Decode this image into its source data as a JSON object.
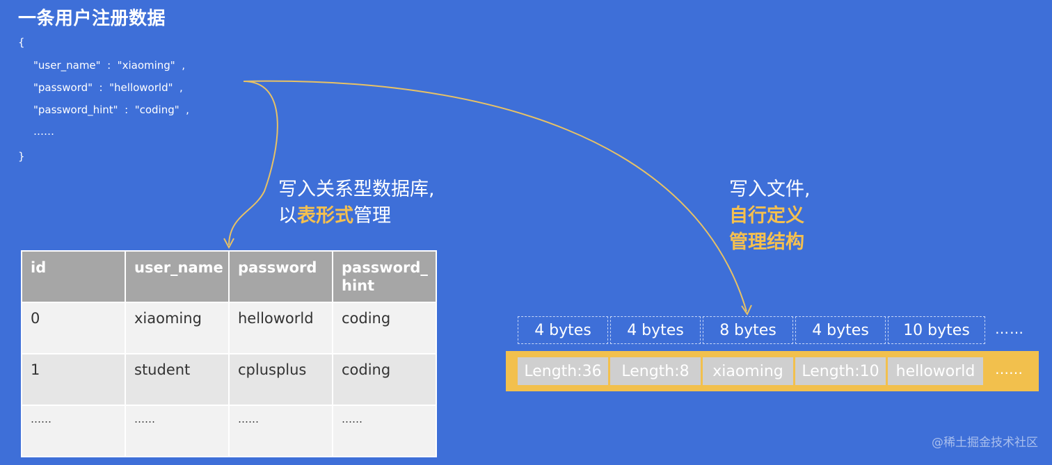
{
  "title": "一条用户注册数据",
  "json_snippet": {
    "open": "{",
    "lines": [
      "\"user_name\"  :  \"xiaoming\"  ,",
      "\"password\"  :  \"helloworld\"  ,",
      "\"password_hint\"  :  \"coding\"  ,",
      "……"
    ],
    "close": "}"
  },
  "relational_label": {
    "line1": "写入关系型数据库,",
    "line2_prefix": "以",
    "line2_highlight": "表形式",
    "line2_suffix": "管理"
  },
  "file_label": {
    "line1": "写入文件,",
    "line2": "自行定义",
    "line3": "管理结构"
  },
  "table": {
    "headers": [
      "id",
      "user_name",
      "password",
      "password_\nhint"
    ],
    "rows": [
      [
        "0",
        "xiaoming",
        "helloworld",
        "coding"
      ],
      [
        "1",
        "student",
        "cplusplus",
        "coding"
      ],
      [
        "……",
        "……",
        "……",
        "……"
      ]
    ]
  },
  "byte_sizes": [
    "4 bytes",
    "4 bytes",
    "8 bytes",
    "4 bytes",
    "10 bytes"
  ],
  "byte_more": "……",
  "file_fields": [
    "Length:36",
    "Length:8",
    "xiaoming",
    "Length:10",
    "helloworld"
  ],
  "file_more": "……",
  "watermark": "@稀土掘金技术社区",
  "colors": {
    "background": "#3e6fd8",
    "highlight": "#f5c04f",
    "strip": "#f2c04d",
    "arrow": "#e8c265"
  }
}
